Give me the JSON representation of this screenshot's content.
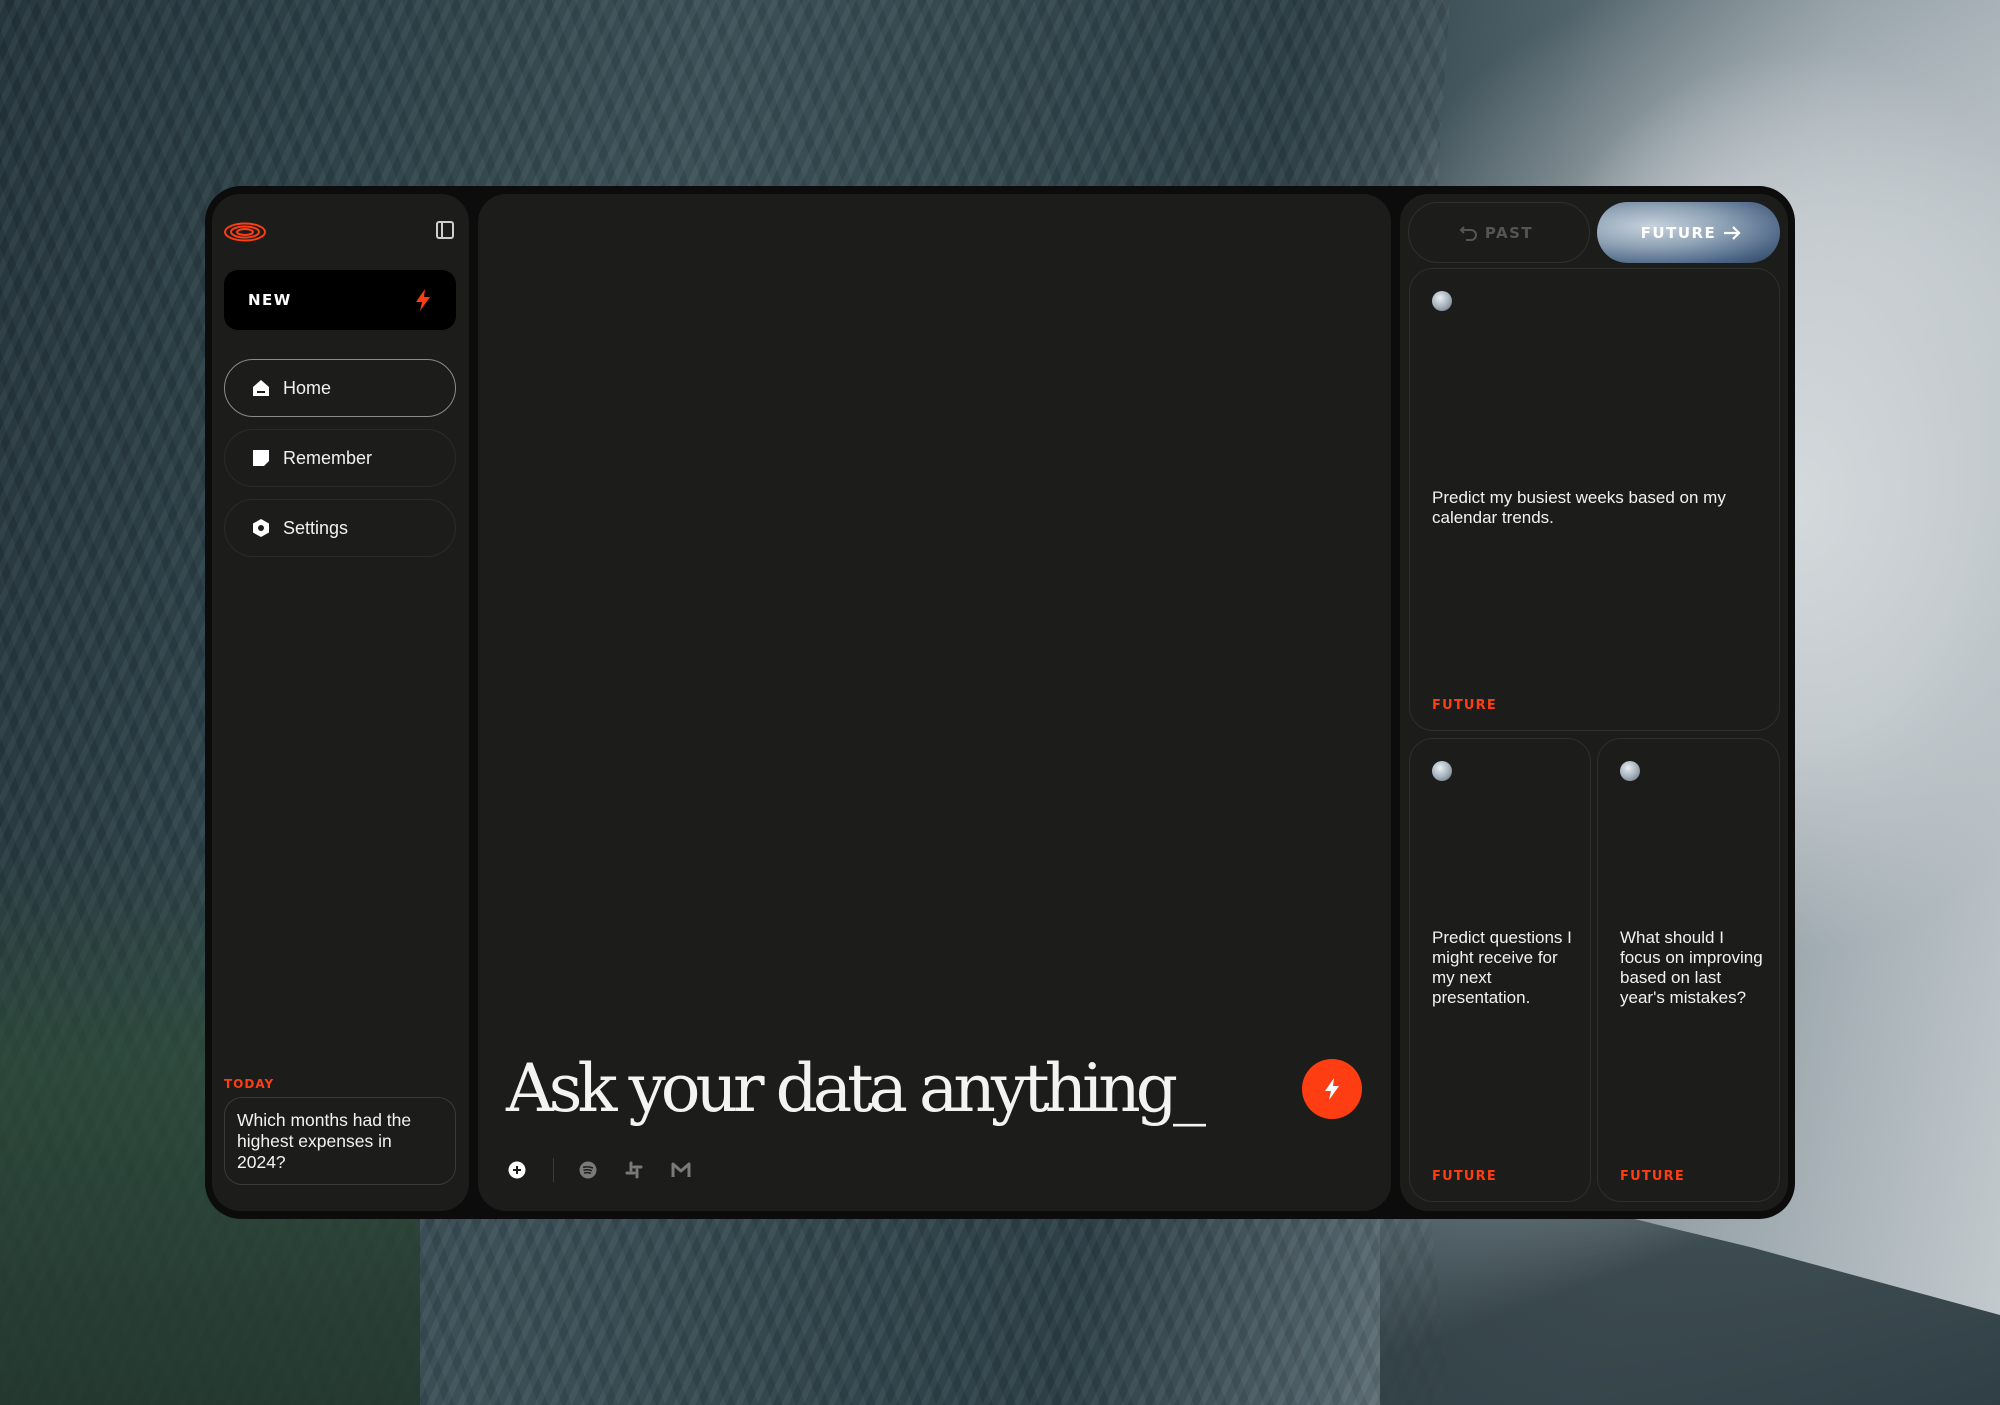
{
  "sidebar": {
    "new_label": "NEW",
    "items": [
      {
        "label": "Home",
        "icon": "home-icon"
      },
      {
        "label": "Remember",
        "icon": "note-icon"
      },
      {
        "label": "Settings",
        "icon": "settings-icon"
      }
    ],
    "history_section_label": "TODAY",
    "history": [
      {
        "text": "Which months had the highest expenses in 2024?"
      }
    ]
  },
  "main": {
    "prompt_text": "Ask your data anything_",
    "tools": [
      "add-icon",
      "spotify-icon",
      "slack-icon",
      "gmail-icon"
    ]
  },
  "right": {
    "past_label": "PAST",
    "future_label": "FUTURE",
    "cards": [
      {
        "text": "Predict my busiest weeks based on my calendar trends.",
        "tag": "FUTURE"
      },
      {
        "text": "Predict questions I might receive for my next presentation.",
        "tag": "FUTURE"
      },
      {
        "text": "What should I focus on improving based on last year's mistakes?",
        "tag": "FUTURE"
      }
    ]
  },
  "colors": {
    "accent": "#ff3d12",
    "panel": "#1c1d1b",
    "frame": "#0b0c0b",
    "text": "#f2f2f2"
  }
}
